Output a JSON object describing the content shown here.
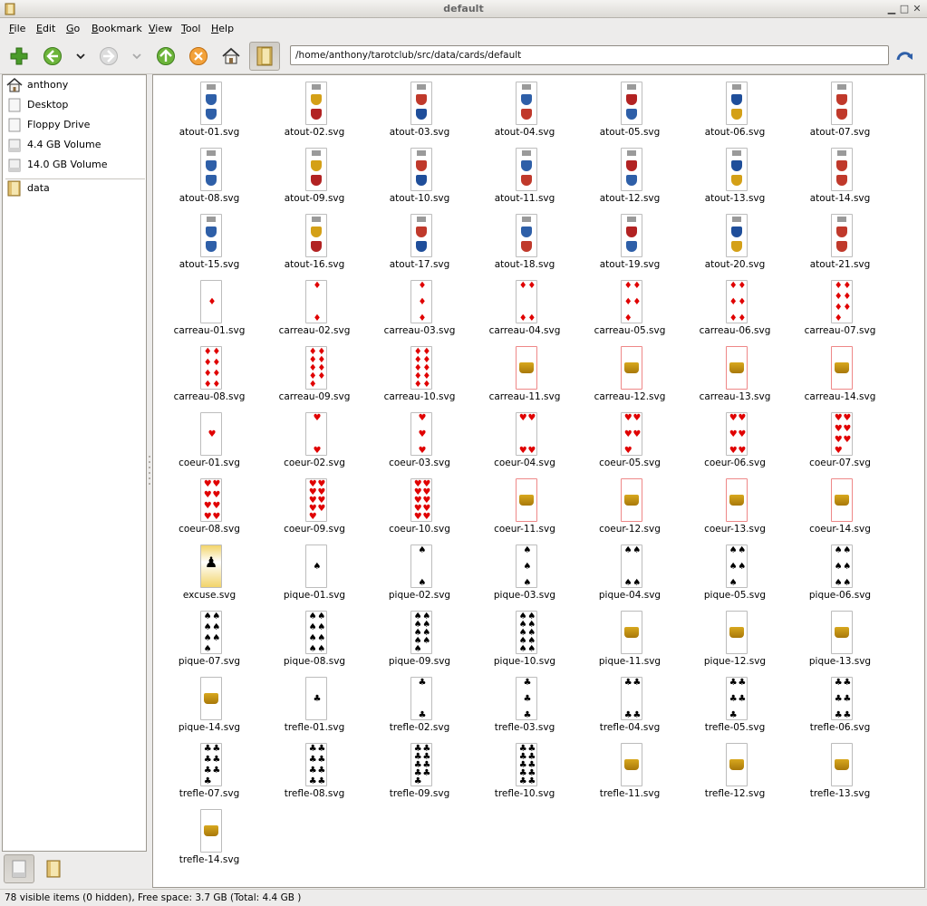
{
  "window": {
    "title": "default"
  },
  "menu": {
    "file": "File",
    "edit": "Edit",
    "go": "Go",
    "bookmark": "Bookmark",
    "view": "View",
    "tool": "Tool",
    "help": "Help"
  },
  "toolbar": {
    "address": "/home/anthony/tarotclub/src/data/cards/default"
  },
  "sidebar": {
    "items": [
      {
        "label": "anthony",
        "icon": "home-icon"
      },
      {
        "label": "Desktop",
        "icon": "desktop-icon"
      },
      {
        "label": "Floppy Drive",
        "icon": "floppy-icon"
      },
      {
        "label": "4.4 GB Volume",
        "icon": "drive-icon"
      },
      {
        "label": "14.0 GB Volume",
        "icon": "drive-icon"
      },
      {
        "label": "data",
        "icon": "bookmark-folder-icon"
      }
    ]
  },
  "files": [
    "atout-01.svg",
    "atout-02.svg",
    "atout-03.svg",
    "atout-04.svg",
    "atout-05.svg",
    "atout-06.svg",
    "atout-07.svg",
    "atout-08.svg",
    "atout-09.svg",
    "atout-10.svg",
    "atout-11.svg",
    "atout-12.svg",
    "atout-13.svg",
    "atout-14.svg",
    "atout-15.svg",
    "atout-16.svg",
    "atout-17.svg",
    "atout-18.svg",
    "atout-19.svg",
    "atout-20.svg",
    "atout-21.svg",
    "carreau-01.svg",
    "carreau-02.svg",
    "carreau-03.svg",
    "carreau-04.svg",
    "carreau-05.svg",
    "carreau-06.svg",
    "carreau-07.svg",
    "carreau-08.svg",
    "carreau-09.svg",
    "carreau-10.svg",
    "carreau-11.svg",
    "carreau-12.svg",
    "carreau-13.svg",
    "carreau-14.svg",
    "coeur-01.svg",
    "coeur-02.svg",
    "coeur-03.svg",
    "coeur-04.svg",
    "coeur-05.svg",
    "coeur-06.svg",
    "coeur-07.svg",
    "coeur-08.svg",
    "coeur-09.svg",
    "coeur-10.svg",
    "coeur-11.svg",
    "coeur-12.svg",
    "coeur-13.svg",
    "coeur-14.svg",
    "excuse.svg",
    "pique-01.svg",
    "pique-02.svg",
    "pique-03.svg",
    "pique-04.svg",
    "pique-05.svg",
    "pique-06.svg",
    "pique-07.svg",
    "pique-08.svg",
    "pique-09.svg",
    "pique-10.svg",
    "pique-11.svg",
    "pique-12.svg",
    "pique-13.svg",
    "pique-14.svg",
    "trefle-01.svg",
    "trefle-02.svg",
    "trefle-03.svg",
    "trefle-04.svg",
    "trefle-05.svg",
    "trefle-06.svg",
    "trefle-07.svg",
    "trefle-08.svg",
    "trefle-09.svg",
    "trefle-10.svg",
    "trefle-11.svg",
    "trefle-12.svg",
    "trefle-13.svg",
    "trefle-14.svg"
  ],
  "status": {
    "text": "78 visible items (0 hidden), Free space: 3.7 GB (Total: 4.4 GB )"
  },
  "colors": {
    "accent_green": "#4a9b2a",
    "red_suit": "#e00000",
    "black_suit": "#000000"
  }
}
